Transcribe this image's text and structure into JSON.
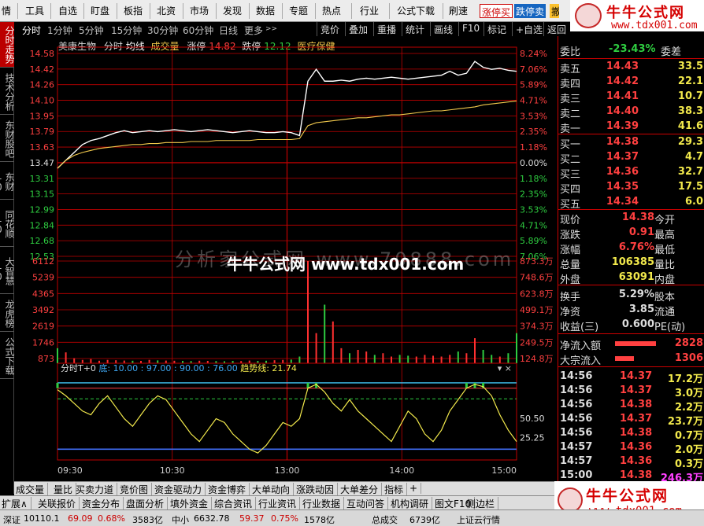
{
  "menubar": {
    "items": [
      "情",
      "工具",
      "自选",
      "盯盘",
      "板指",
      "北资",
      "市场",
      "发现",
      "数据",
      "专题",
      "热点",
      "行业",
      "公式下载",
      "刷速"
    ],
    "tags": [
      "涨停买",
      "跌停卖",
      "撤"
    ]
  },
  "logo": {
    "cn": "牛牛公式网",
    "url": "www.tdx001.com"
  },
  "left_tabs": [
    "分时走势",
    "技术分析",
    "东财股吧",
    "东财10",
    "同花顺10",
    "大智慧10",
    "龙虎榜",
    "公式下载"
  ],
  "period_tabs": [
    "分时",
    "1分钟",
    "5分钟",
    "15分钟",
    "30分钟",
    "60分钟",
    "日线",
    "更多"
  ],
  "tool_buttons": [
    "竞价",
    "叠加",
    "重播",
    "统计",
    "画线",
    "F10",
    "标记",
    "+自选",
    "返回"
  ],
  "stock": {
    "name": "美康生物",
    "mode": "分时",
    "avg": "均线",
    "vol": "成交量",
    "zt_label": "涨停",
    "zt_value": "14.82",
    "dt_label": "跌停",
    "dt_value": "12.12",
    "sector": "医疗保健"
  },
  "chart_data": {
    "type": "line",
    "y_price_ticks": [
      "14.58",
      "14.42",
      "14.26",
      "14.10",
      "13.95",
      "13.79",
      "13.63",
      "13.47",
      "13.31",
      "13.15",
      "12.99",
      "12.84",
      "12.68",
      "12.53"
    ],
    "y_pct_ticks": [
      "8.24%",
      "7.06%",
      "5.89%",
      "4.71%",
      "3.53%",
      "2.35%",
      "1.18%",
      "0.00%",
      "1.18%",
      "2.35%",
      "3.53%",
      "4.71%",
      "5.89%",
      "7.06%"
    ],
    "y_vol_ticks": [
      "6112",
      "5239",
      "4365",
      "3492",
      "2619",
      "1746",
      "873"
    ],
    "y_amt_ticks": [
      "873.3万",
      "748.6万",
      "623.8万",
      "499.1万",
      "374.3万",
      "249.5万",
      "124.8万"
    ],
    "x_ticks": [
      "09:30",
      "10:30",
      "13:00",
      "14:00",
      "15:00"
    ],
    "prev_close": 13.47,
    "price": [
      13.42,
      13.5,
      13.58,
      13.66,
      13.7,
      13.72,
      13.75,
      13.78,
      13.8,
      13.78,
      13.79,
      13.8,
      13.79,
      13.8,
      13.81,
      13.8,
      13.79,
      13.8,
      13.81,
      13.8,
      13.79,
      13.78,
      13.79,
      13.8,
      13.79,
      13.78,
      13.78,
      13.79,
      13.78,
      13.75,
      14.3,
      14.42,
      14.3,
      14.3,
      14.31,
      14.3,
      14.32,
      14.33,
      14.32,
      14.33,
      14.34,
      14.33,
      14.32,
      14.33,
      14.34,
      14.35,
      14.36,
      14.4,
      14.36,
      14.38,
      14.5,
      14.44,
      14.42,
      14.43,
      14.41,
      14.4
    ],
    "avg": [
      13.42,
      13.5,
      13.55,
      13.58,
      13.6,
      13.62,
      13.63,
      13.64,
      13.65,
      13.66,
      13.66,
      13.67,
      13.67,
      13.68,
      13.68,
      13.68,
      13.69,
      13.69,
      13.69,
      13.7,
      13.7,
      13.7,
      13.7,
      13.7,
      13.71,
      13.71,
      13.71,
      13.71,
      13.71,
      13.72,
      13.85,
      13.88,
      13.89,
      13.9,
      13.91,
      13.92,
      13.93,
      13.93,
      13.94,
      13.95,
      13.96,
      13.96,
      13.97,
      13.98,
      13.99,
      14.0,
      14.0,
      14.01,
      14.02,
      14.03,
      14.04,
      14.06,
      14.07,
      14.08,
      14.09,
      14.1
    ],
    "volume": [
      900,
      650,
      300,
      200,
      250,
      150,
      200,
      180,
      160,
      150,
      140,
      200,
      170,
      160,
      150,
      140,
      130,
      150,
      140,
      130,
      120,
      140,
      130,
      160,
      140,
      150,
      180,
      200,
      220,
      400,
      6112,
      1800,
      3500,
      2500,
      900,
      600,
      800,
      700,
      500,
      600,
      400,
      500,
      450,
      400,
      500,
      450,
      400,
      500,
      700,
      600,
      1500,
      800,
      500,
      400,
      600,
      1800
    ],
    "indicator": {
      "name": "分时T+0",
      "params": "底: 10.00 : 97.00 : 90.00 : 76.00",
      "trend_label": "趋势线",
      "trend_value": "21.74",
      "y_ticks": [
        "50.50",
        "25.25"
      ],
      "trend": [
        88,
        80,
        70,
        60,
        55,
        70,
        80,
        65,
        50,
        40,
        55,
        70,
        80,
        75,
        60,
        45,
        30,
        20,
        35,
        50,
        45,
        30,
        20,
        10,
        5,
        15,
        30,
        45,
        40,
        50,
        90,
        95,
        85,
        70,
        60,
        75,
        60,
        50,
        40,
        30,
        20,
        40,
        60,
        50,
        30,
        20,
        35,
        60,
        75,
        90,
        95,
        92,
        80,
        55,
        35,
        20
      ]
    }
  },
  "right": {
    "webi_label": "委比",
    "webi_value": "-23.43%",
    "weicha_label": "委差",
    "sell": [
      {
        "label": "卖五",
        "price": "14.43",
        "vol": "33.5"
      },
      {
        "label": "卖四",
        "price": "14.42",
        "vol": "22.1"
      },
      {
        "label": "卖三",
        "price": "14.41",
        "vol": "10.7"
      },
      {
        "label": "卖二",
        "price": "14.40",
        "vol": "38.3"
      },
      {
        "label": "卖一",
        "price": "14.39",
        "vol": "41.6"
      }
    ],
    "buy": [
      {
        "label": "买一",
        "price": "14.38",
        "vol": "29.3"
      },
      {
        "label": "买二",
        "price": "14.37",
        "vol": "4.7"
      },
      {
        "label": "买三",
        "price": "14.36",
        "vol": "32.7"
      },
      {
        "label": "买四",
        "price": "14.35",
        "vol": "17.5"
      },
      {
        "label": "买五",
        "price": "14.34",
        "vol": "6.0"
      }
    ],
    "quote": [
      {
        "k1": "现价",
        "v1": "14.38",
        "k2": "今开"
      },
      {
        "k1": "涨跌",
        "v1": "0.91",
        "k2": "最高"
      },
      {
        "k1": "涨幅",
        "v1": "6.76%",
        "k2": "最低"
      },
      {
        "k1": "总量",
        "v1": "106385",
        "k2": "量比"
      },
      {
        "k1": "外盘",
        "v1": "63091",
        "k2": "内盘"
      }
    ],
    "info": [
      {
        "k1": "换手",
        "v1": "5.29%",
        "k2": "股本"
      },
      {
        "k1": "净资",
        "v1": "3.85",
        "k2": "流通"
      },
      {
        "k1": "收益(三)",
        "v1": "0.600",
        "k2": "PE(动)"
      }
    ],
    "flow": [
      {
        "k": "净流入额",
        "v": "2828"
      },
      {
        "k": "大宗流入",
        "v": "1306"
      }
    ],
    "ticks": [
      {
        "t": "14:56",
        "p": "14.37",
        "v": "17.2万"
      },
      {
        "t": "14:56",
        "p": "14.37",
        "v": "3.0万"
      },
      {
        "t": "14:56",
        "p": "14.38",
        "v": "2.2万"
      },
      {
        "t": "14:56",
        "p": "14.37",
        "v": "23.7万"
      },
      {
        "t": "14:56",
        "p": "14.38",
        "v": "0.7万"
      },
      {
        "t": "14:57",
        "p": "14.36",
        "v": "2.0万"
      },
      {
        "t": "14:57",
        "p": "14.36",
        "v": "0.3万"
      },
      {
        "t": "15:00",
        "p": "14.38",
        "v": "246.3万"
      }
    ]
  },
  "bottom_tabs1": [
    "成交量",
    "量比",
    "买卖力道",
    "竞价图",
    "资金驱动力",
    "资金博弈",
    "大单动向",
    "涨跌动因",
    "大单差分",
    "指标",
    "+"
  ],
  "bottom_tabs2": [
    "扩展∧",
    "关联报价",
    "资金分布",
    "盘面分析",
    "填外资金",
    "综合资讯",
    "行业资讯",
    "行业数据",
    "互动问答",
    "机构调研",
    "图文F10",
    "侧边栏"
  ],
  "status": {
    "s1": "深证",
    "s2": "10110.1",
    "s3": "69.09",
    "s4": "0.68%",
    "s5": "3583亿",
    "s6": "中小",
    "s7": "6632.78",
    "s8": "59.37",
    "s9": "0.75%",
    "s10": "1578亿",
    "s11": "总成交",
    "s12": "6739亿",
    "s13": "上证云行情"
  },
  "watermark": {
    "faint": "分析家公式网 www.70888.com",
    "strong": "牛牛公式网 www.tdx001.com"
  }
}
